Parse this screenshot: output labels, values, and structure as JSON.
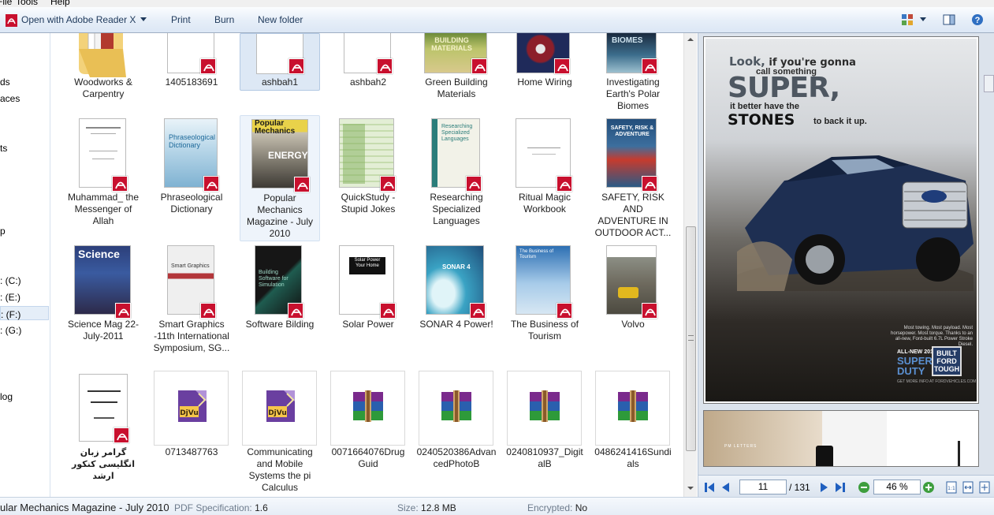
{
  "menu": {
    "items": [
      "File",
      "Tools",
      "Help"
    ]
  },
  "toolbar": {
    "open_with_label": "Open with Adobe Reader X",
    "print_label": "Print",
    "burn_label": "Burn",
    "new_folder_label": "New folder"
  },
  "nav": {
    "items": [
      {
        "label": "ds"
      },
      {
        "label": "aces"
      },
      {
        "label": "ts"
      },
      {
        "label": "p"
      },
      {
        "label": ": (C:)"
      },
      {
        "label": ": (E:)"
      },
      {
        "label": ": (F:)"
      },
      {
        "label": ": (G:)"
      },
      {
        "label": "log"
      }
    ]
  },
  "files": {
    "row1": [
      "Woodworks & Carpentry",
      "1405183691",
      "ashbah1",
      "ashbah2",
      "Green Building Materials",
      "Home Wiring",
      "Investigating Earth's Polar Biomes"
    ],
    "row2": [
      "Muhammad_ the Messenger of Allah",
      "Phraseological Dictionary",
      "Popular Mechanics Magazine - July 2010",
      "QuickStudy - Stupid Jokes",
      "Researching Specialized Languages",
      "Ritual Magic Workbook",
      "SAFETY, RISK AND ADVENTURE IN OUTDOOR ACT..."
    ],
    "row3": [
      "Science Mag 22-July-2011",
      "Smart Graphics -11th International Symposium, SG...",
      "Software Bilding",
      "Solar Power",
      "SONAR 4 Power!",
      "The Business of Tourism",
      "Volvo"
    ],
    "row4": [
      "گرامر زبان انگلیسی کنکور ارشد",
      "0713487763",
      "Communicating and Mobile Systems the pi Calculus",
      "0071664076Drug Guid",
      "0240520386AdvancedPhotoB",
      "0240810937_DigitalB",
      "0486241416Sundials"
    ]
  },
  "covers": {
    "green_building": "BUILDING MATERIALS",
    "biomes": "BIOMES",
    "phraseological": "Phraseological Dictionary",
    "popular_mechanics": "Popular Mechanics",
    "energy": "ENERGY",
    "researching": "Researching Specialized Languages",
    "safety": "SAFETY, RISK & ADVENTURE",
    "science": "Science",
    "smart_graphics": "Smart Graphics",
    "software": "Building Software for Simulation",
    "solar": "Solar Power Your Home",
    "sonar": "SONAR 4",
    "tourism": "The Business of Tourism",
    "djvu": "DjVu"
  },
  "preview": {
    "ad_look": "Look,",
    "ad_gonna": " if you're gonna",
    "ad_call": "call something",
    "ad_super": "SUPER,",
    "ad_better": "it better have the",
    "ad_stones": "STONES",
    "ad_backit": "to back it up.",
    "ad_tagline": "Most towing. Most payload. Most horsepower. Most torque. Thanks to an all-new, Ford-built 6.7L Power Stroke Diesel.",
    "ad_allnew": "ALL-NEW 2011",
    "ad_superduty": "SUPER DUTY",
    "ad_builttough": "BUILT FORD TOUGH",
    "ad_more": "GET MORE INFO AT FORDVEHICLES.COM",
    "page2_label": "PM LETTERS",
    "current_page": "11",
    "total_pages": "/ 131",
    "zoom": "46 %"
  },
  "details": {
    "title": "ular Mechanics Magazine - July 2010",
    "pdf_spec_key": "PDF Specification:",
    "pdf_spec_val": "1.6",
    "size_key": "Size:",
    "size_val": "12.8 MB",
    "encrypted_key": "Encrypted:",
    "encrypted_val": "No"
  },
  "colors": {
    "pdf_red": "#c8102e",
    "selection": "#dde8f5",
    "toolbar_text": "#1e395b"
  }
}
